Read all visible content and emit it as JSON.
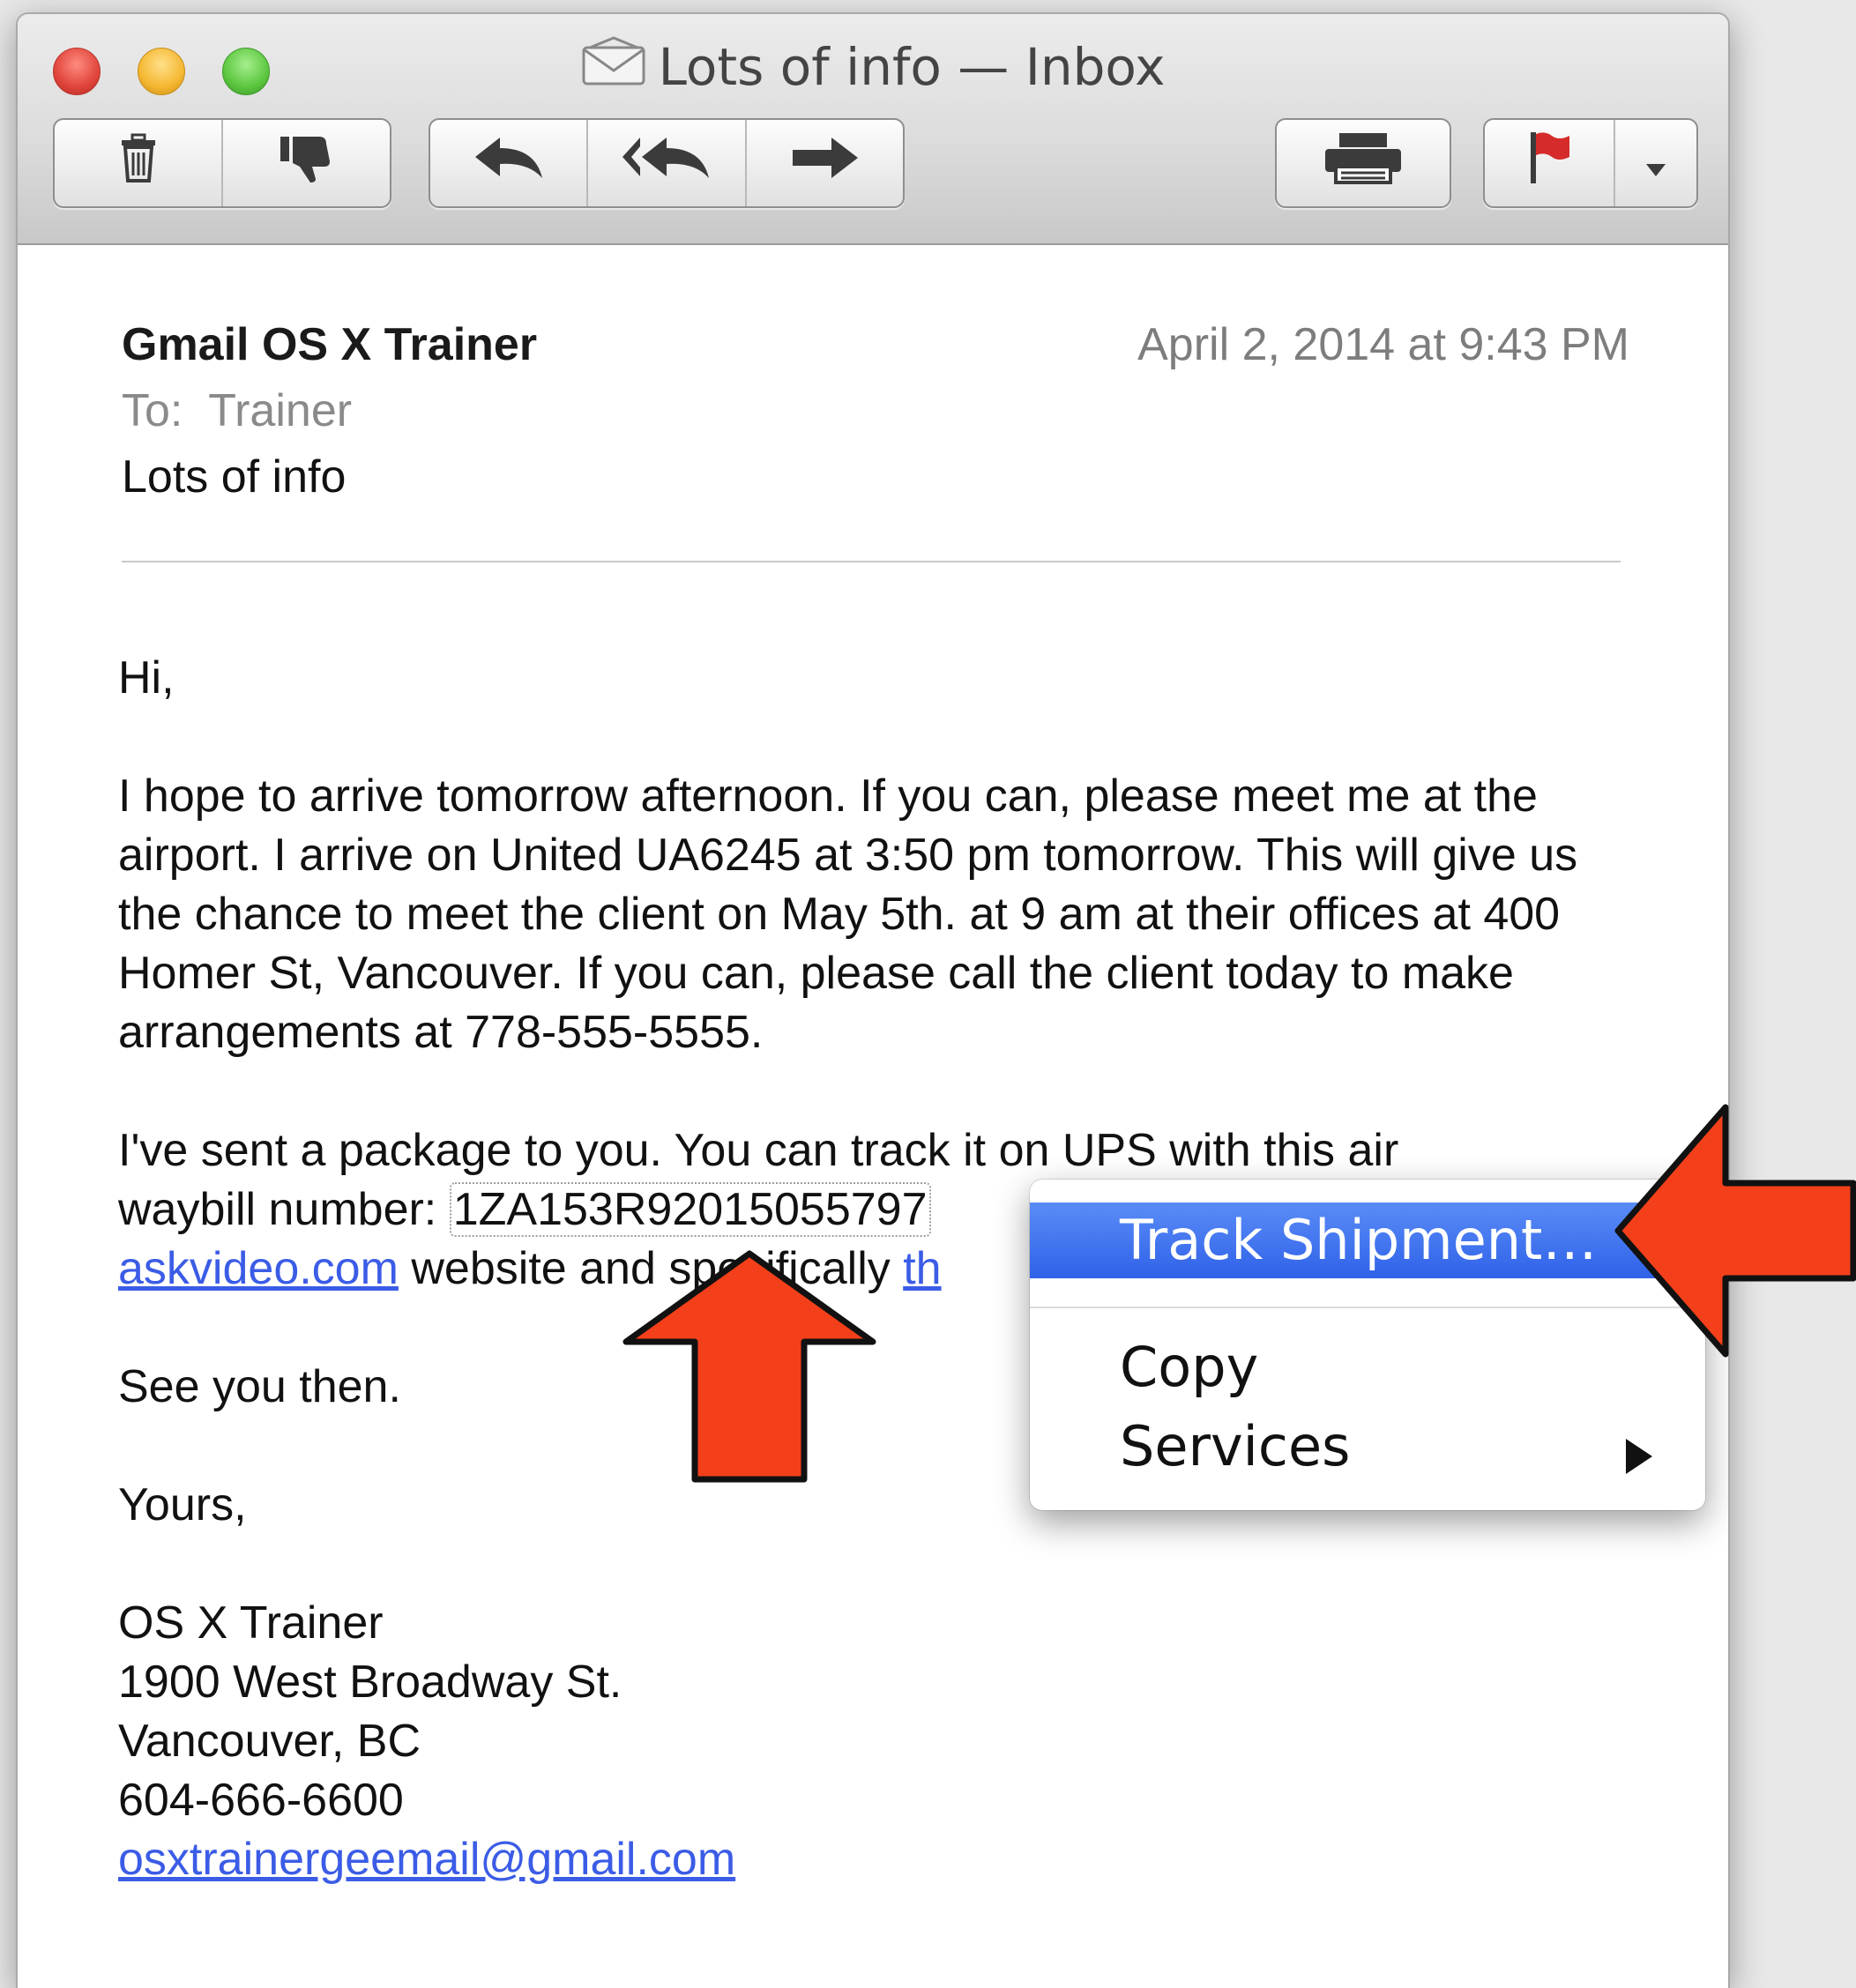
{
  "window": {
    "title": "Lots of info — Inbox"
  },
  "toolbar": {
    "delete_icon": "trash-icon",
    "junk_icon": "thumbs-down-icon",
    "reply_icon": "reply-icon",
    "reply_all_icon": "reply-all-icon",
    "forward_icon": "forward-icon",
    "print_icon": "printer-icon",
    "flag_icon": "flag-icon",
    "flag_color": "#d62b2b"
  },
  "message": {
    "from": "Gmail OS X Trainer",
    "date": "April 2, 2014 at 9:43 PM",
    "to_label": "To:",
    "to": "Trainer",
    "subject": "Lots of info",
    "greeting": "Hi,",
    "para1": "I hope to arrive tomorrow afternoon.  If you can, please meet me at the airport. I arrive on United UA6245 at 3:50 pm tomorrow. This will give us the chance to meet the client on May 5th. at 9 am at their offices at 400 Homer St, Vancouver.  If you can, please call the client today to make arrangements at 778-555-5555.",
    "para2_a": "I've sent a package to you.  You can track it on UPS with this air",
    "para2_b": "waybill number:",
    "waybill": "1ZA153R92015055797",
    "link1": "askvideo.com",
    "para2_c": " website and specifically ",
    "link2": "th",
    "closing1": "See you then.",
    "closing2": "Yours,",
    "sig_name": "OS X Trainer",
    "sig_addr1": "1900 West Broadway St.",
    "sig_addr2": "Vancouver, BC",
    "sig_phone": "604-666-6600",
    "sig_email": "osxtrainergeemail@gmail.com"
  },
  "context_menu": {
    "items": [
      "Track Shipment…",
      "Copy",
      "Services"
    ],
    "selected": "Track Shipment…"
  },
  "annotations": {
    "arrow_color": "#f4401a"
  }
}
